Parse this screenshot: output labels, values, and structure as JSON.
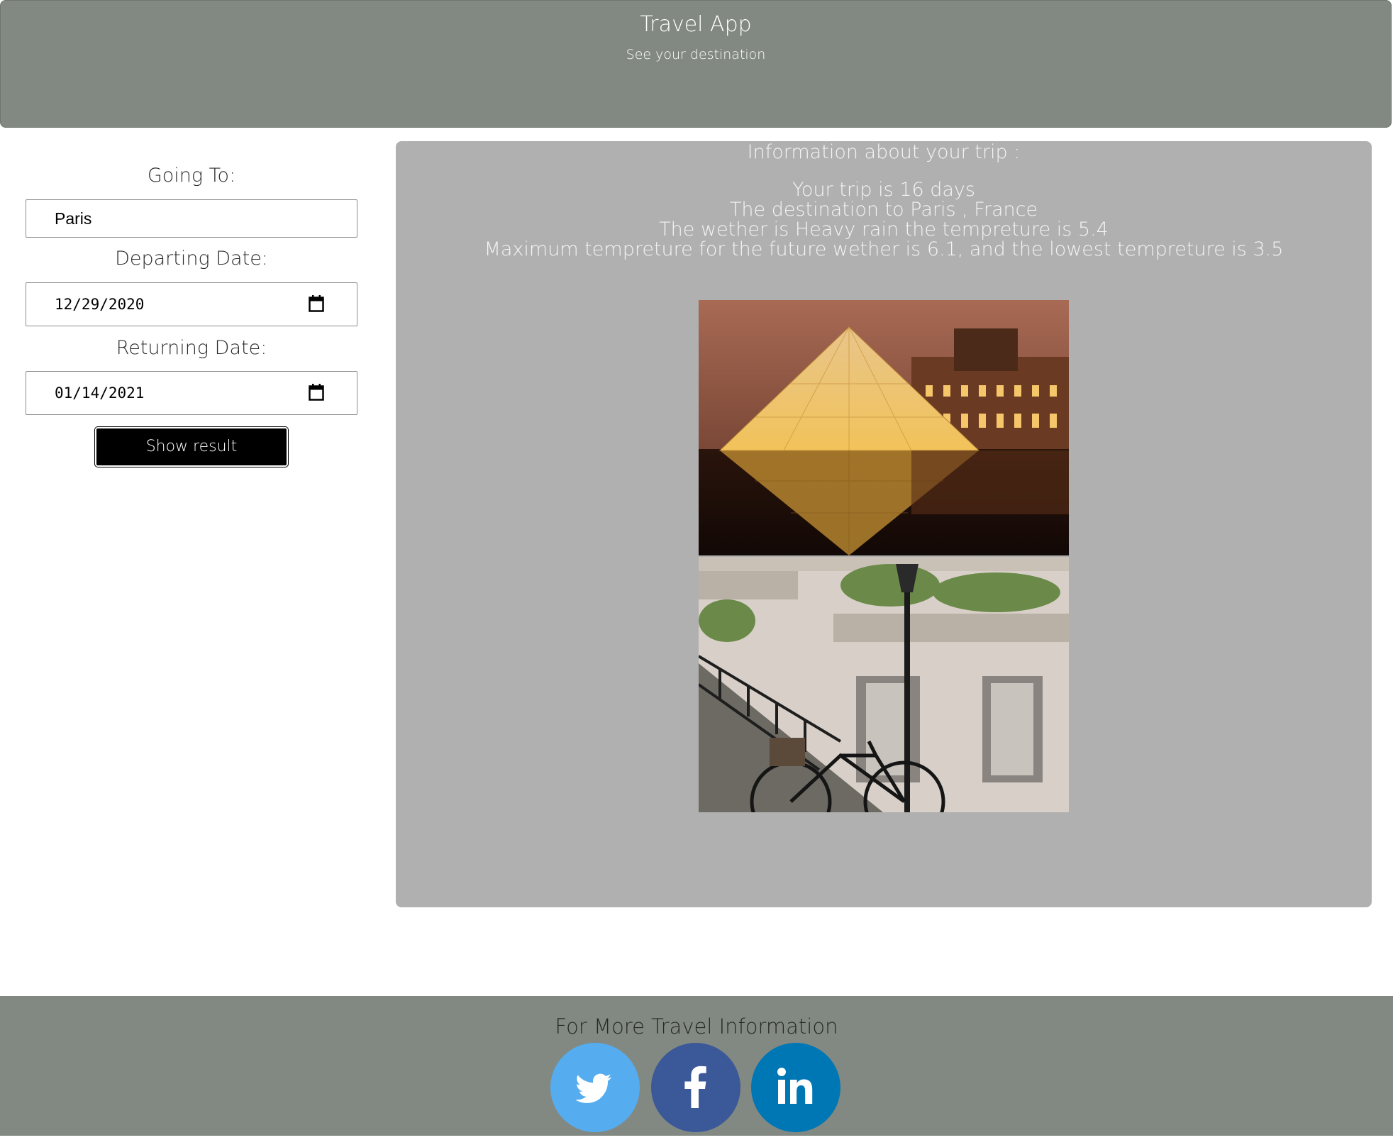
{
  "header": {
    "title": "Travel App",
    "subtitle": "See your destination"
  },
  "form": {
    "going_to_label": "Going To:",
    "going_to_value": "Paris",
    "departing_label": "Departing Date:",
    "departing_value": "12/29/2020",
    "returning_label": "Returning Date:",
    "returning_value": "01/14/2021",
    "submit_label": "Show result"
  },
  "info": {
    "heading": "Information about your trip :",
    "trip_length": "Your trip is 16 days",
    "destination": "The destination to Paris , France",
    "weather": "The wether is Heavy rain the tempreture is 5.4",
    "forecast": "Maximum tempreture for the future wether is 6.1, and the lowest tempreture is 3.5"
  },
  "footer": {
    "title": "For More Travel Information",
    "links": [
      "twitter-icon",
      "facebook-icon",
      "linkedin-icon"
    ]
  },
  "colors": {
    "header_bg": "#828982",
    "panel_bg": "#b0b0b0",
    "button_bg": "#000000",
    "twitter": "#55acee",
    "facebook": "#3b5998",
    "linkedin": "#0077b5"
  }
}
